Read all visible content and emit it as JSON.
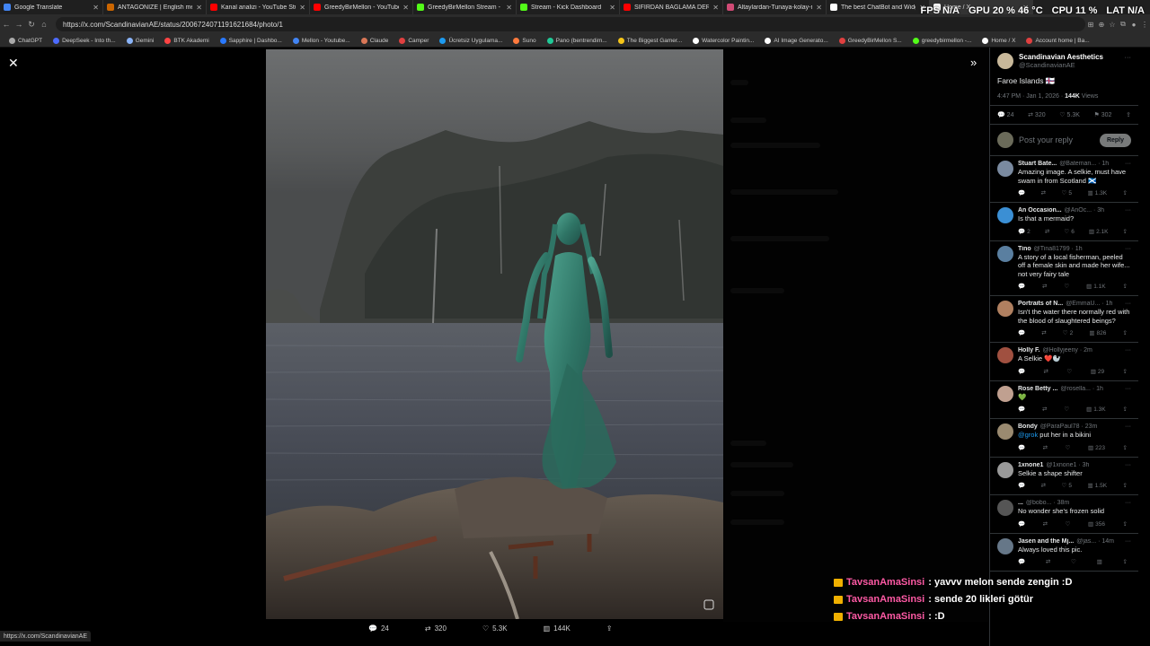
{
  "tabs": [
    {
      "label": "Google Translate",
      "color": "#4285f4"
    },
    {
      "label": "ANTAGONIZE | English meaning",
      "color": "#cc6600"
    },
    {
      "label": "Kanal analizi - YouTube Studio",
      "color": "#ff0000"
    },
    {
      "label": "GreedyBirMellon - YouTube",
      "color": "#ff0000"
    },
    {
      "label": "GreedyBirMellon Stream - Watch",
      "color": "#53fc18"
    },
    {
      "label": "Stream - Kick Dashboard",
      "color": "#53fc18"
    },
    {
      "label": "SIFIRDAN BAĞLAMA DERSLERİ",
      "color": "#ff0000"
    },
    {
      "label": "Altaylardan-Tunaya-kolay-nota-...",
      "color": "#d04a75"
    },
    {
      "label": "The best ChatBot and Widgets f...",
      "color": "#ffffff"
    },
    {
      "label": "Home / X",
      "color": "#ffffff"
    }
  ],
  "hud": {
    "fps_label": "FPS",
    "fps": "N/A",
    "gpu_label": "GPU",
    "gpu": "20 %  46 °C",
    "cpu_label": "CPU",
    "cpu": "11 %",
    "lat_label": "LAT",
    "lat": "N/A"
  },
  "url": "https://x.com/ScandinavianAE/status/2006724071191621684/photo/1",
  "bookmarks": [
    {
      "label": "ChatGPT",
      "color": "#aaa"
    },
    {
      "label": "DeepSeek - Into th...",
      "color": "#4d6bfe"
    },
    {
      "label": "Gemini",
      "color": "#8ab4f8"
    },
    {
      "label": "BTK Akademi",
      "color": "#ff4444"
    },
    {
      "label": "Sapphire | Dashbo...",
      "color": "#2979ff"
    },
    {
      "label": "Mellon - Youtube...",
      "color": "#4285f4"
    },
    {
      "label": "Claude",
      "color": "#d97757"
    },
    {
      "label": "Camper",
      "color": "#e04040"
    },
    {
      "label": "Ücretsiz Uygulama...",
      "color": "#1d9bf0"
    },
    {
      "label": "Suno",
      "color": "#ff7a3d"
    },
    {
      "label": "Pano (bentrendim...",
      "color": "#20c997"
    },
    {
      "label": "The Biggest Gamer...",
      "color": "#f5c518"
    },
    {
      "label": "Watercolor Paintin...",
      "color": "#ffffff"
    },
    {
      "label": "AI Image Generato...",
      "color": "#ffffff"
    },
    {
      "label": "GreedyBirMellon S...",
      "color": "#e04040"
    },
    {
      "label": "greedybirmellon -...",
      "color": "#53fc18"
    },
    {
      "label": "Home / X",
      "color": "#ffffff"
    },
    {
      "label": "Account home | Ba...",
      "color": "#e04040"
    }
  ],
  "photo_actions": {
    "replies": "24",
    "reposts": "320",
    "likes": "5.3K",
    "views": "144K"
  },
  "post": {
    "author": "Scandinavian Aesthetics",
    "handle": "@ScandinavianAE",
    "text": "Faroe Islands 🇫🇴",
    "time": "4:47 PM · Jan 1, 2026 · ",
    "views": "144K",
    "views_label": " Views",
    "replies": "24",
    "reposts": "320",
    "likes": "5.3K",
    "bookmarks": "302",
    "reply_placeholder": "Post your reply",
    "reply_button": "Reply"
  },
  "replies": [
    {
      "name": "Stuart Bate...",
      "handle": "@Bateman... · 1h",
      "text": "Amazing image. A selkie, must have swam in from Scotland 🏴󠁧󠁢󠁳󠁣󠁴󠁿",
      "likes": "5",
      "views": "1.3K",
      "color": "#7a8aa0"
    },
    {
      "name": "An Occasion...",
      "handle": "@AnOc... · 3h",
      "text": "Is that a mermaid?",
      "replies": "2",
      "likes": "6",
      "views": "2.1K",
      "color": "#3b8fd4"
    },
    {
      "name": "Tino",
      "handle": "@Tina81799 · 1h",
      "text": "A story of a local fisherman, peeled off a female skin and made her wife... not very fairy tale",
      "views": "1.1K",
      "color": "#5a7fa0"
    },
    {
      "name": "Portraits of N...",
      "handle": "@EmmaU... · 1h",
      "text": "Isn't the water there normally red with the blood of slaughtered beings?",
      "likes": "2",
      "views": "826",
      "color": "#b08060"
    },
    {
      "name": "Holly F.",
      "handle": "@Hollyjeeny · 2m",
      "text": "A Selkie ❤️🦭",
      "views": "29",
      "color": "#a05040"
    },
    {
      "name": "Rose Betty ...",
      "handle": "@rosella... · 1h",
      "text": "💚",
      "views": "1.3K",
      "color": "#c0a090"
    },
    {
      "name": "Bondy",
      "handle": "@ParaPaul78 · 23m",
      "mention": "@grok",
      "text": " put her in a bikini",
      "views": "223",
      "color": "#9a8a70"
    },
    {
      "name": "1xnone1",
      "handle": "@1xnone1 · 3h",
      "text": "Selkie  a shape shifter",
      "likes": "5",
      "views": "1.5K",
      "color": "#999"
    },
    {
      "name": "...",
      "handle": "@bobo... · 38m",
      "text": "No wonder she's frozen solid",
      "views": "356",
      "color": "#555"
    },
    {
      "name": "Jasen and the Mj...",
      "handle": "@jas... · 14m",
      "text": "Always loved this pic.",
      "color": "#667788"
    }
  ],
  "chat": [
    {
      "user": "TavsanAmaSinsi",
      "msg": " : yavvv melon sende zengin :D"
    },
    {
      "user": "TavsanAmaSinsi",
      "msg": " : sende 20 likleri götür"
    },
    {
      "user": "TavsanAmaSinsi",
      "msg": " : :D"
    }
  ],
  "status_url": "https://x.com/ScandinavianAE"
}
